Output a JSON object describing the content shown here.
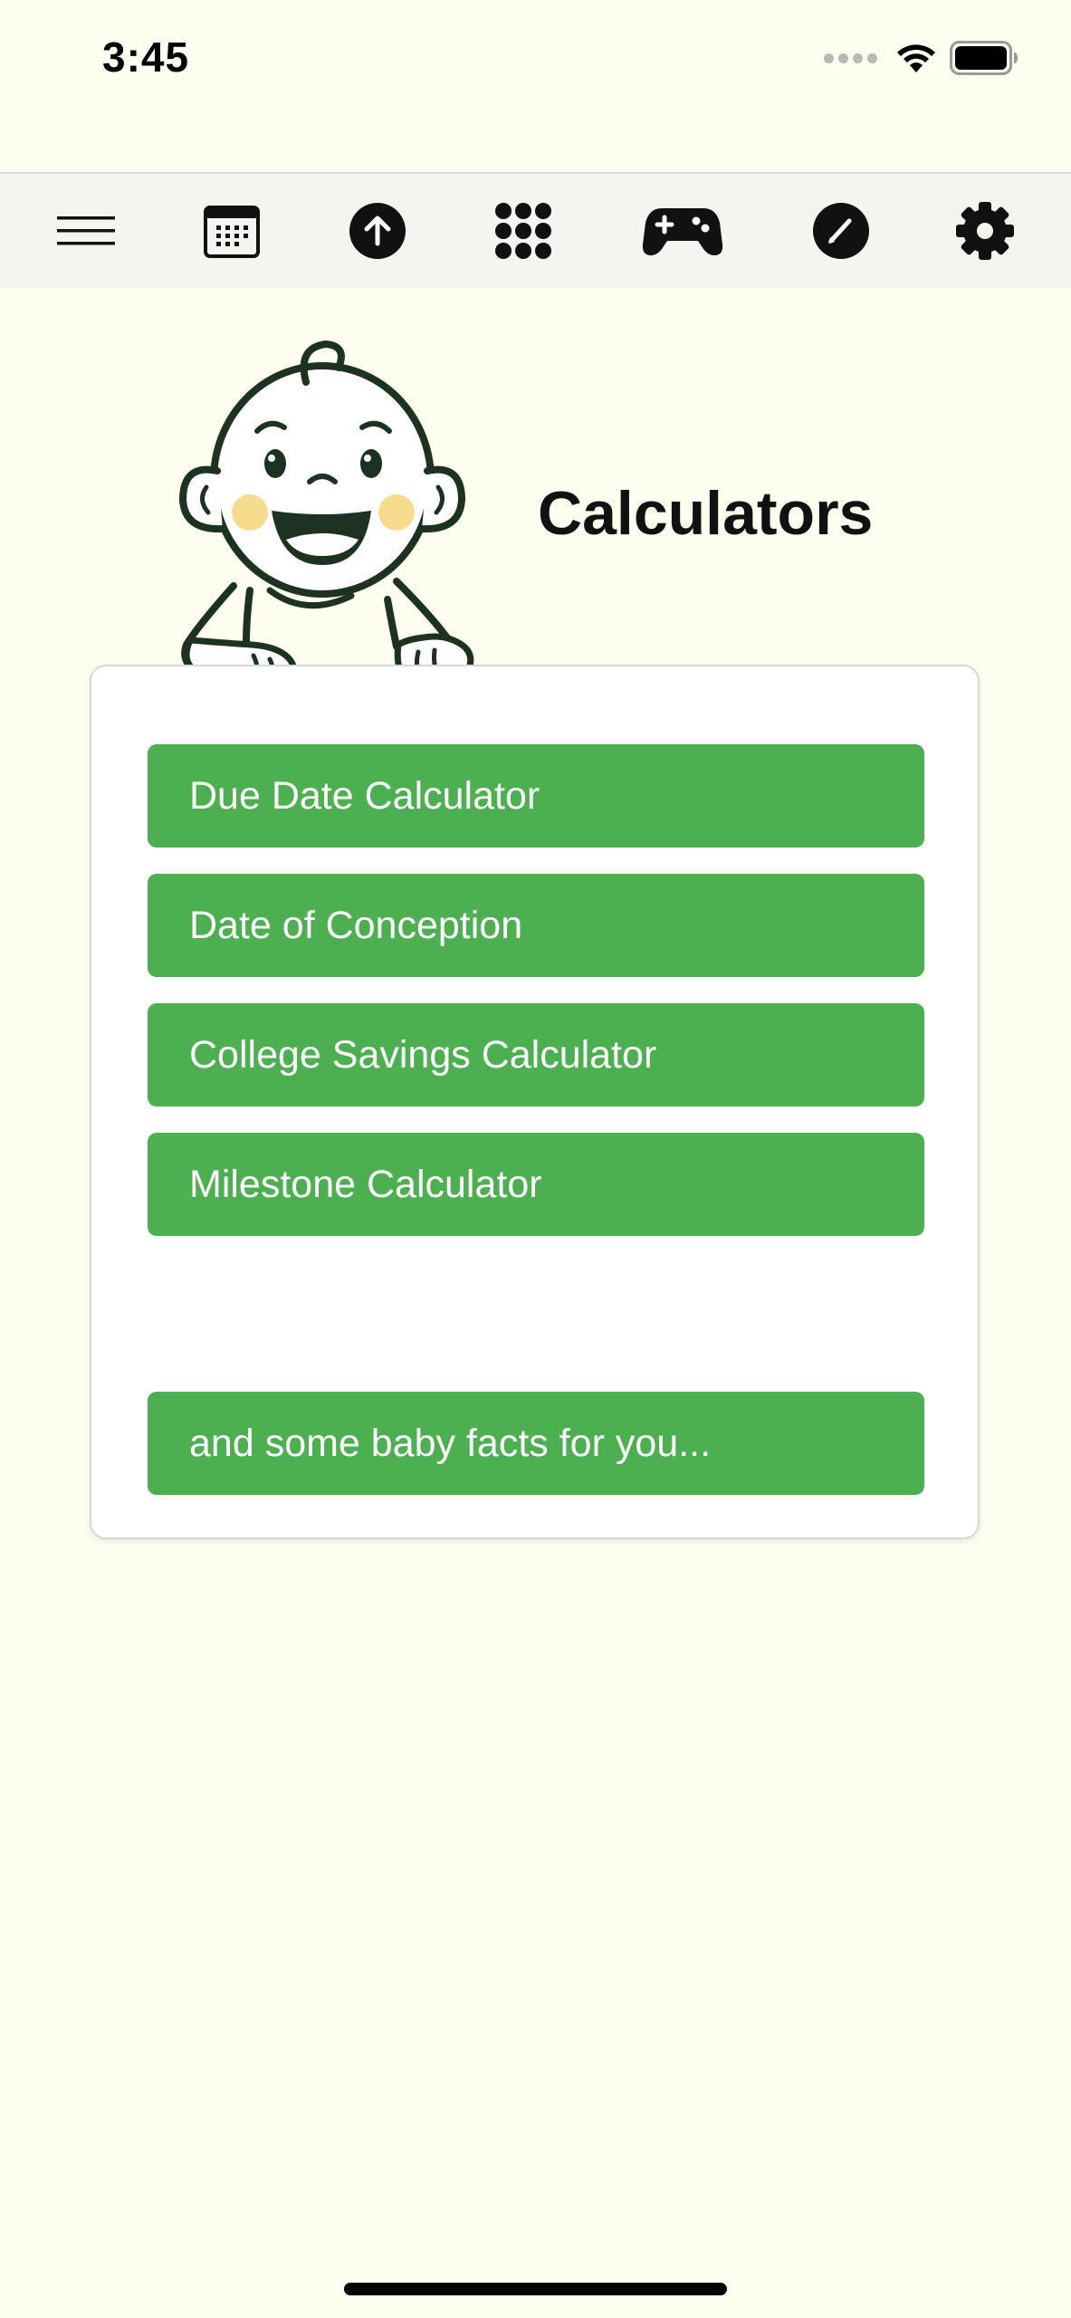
{
  "status_bar": {
    "time": "3:45"
  },
  "toolbar": {
    "icons": [
      "menu-icon",
      "calendar-icon",
      "upload-icon",
      "grid-icon",
      "gamepad-icon",
      "edit-icon",
      "gear-icon"
    ]
  },
  "header": {
    "title": "Calculators"
  },
  "calculators": {
    "items": [
      {
        "label": "Due Date Calculator"
      },
      {
        "label": "Date of Conception"
      },
      {
        "label": "College Savings Calculator"
      },
      {
        "label": "Milestone Calculator"
      }
    ],
    "facts_label": "and some baby facts for you..."
  },
  "colors": {
    "background": "#fefef0",
    "button_green": "#4caf50",
    "toolbar_bg": "#f4f5f1",
    "illustration_stroke": "#1d3220",
    "cheek": "#f8dc8e"
  }
}
